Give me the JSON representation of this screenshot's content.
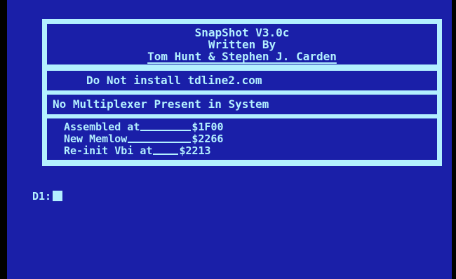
{
  "title": {
    "line1": "SnapShot V3.0c",
    "line2": "Written By",
    "line3": "Tom Hunt & Stephen J. Carden"
  },
  "notices": [
    "Do Not install tdline2.com",
    "No Multiplexer Present in System"
  ],
  "info": [
    {
      "label": "Assembled at",
      "value": "$1F00"
    },
    {
      "label": "New Memlow",
      "value": "$2266"
    },
    {
      "label": "Re-init Vbi at",
      "value": "$2213"
    }
  ],
  "prompt": "D1:",
  "colors": {
    "background": "#1a1fa8",
    "foreground": "#b3f0ff",
    "border": "#000000"
  }
}
